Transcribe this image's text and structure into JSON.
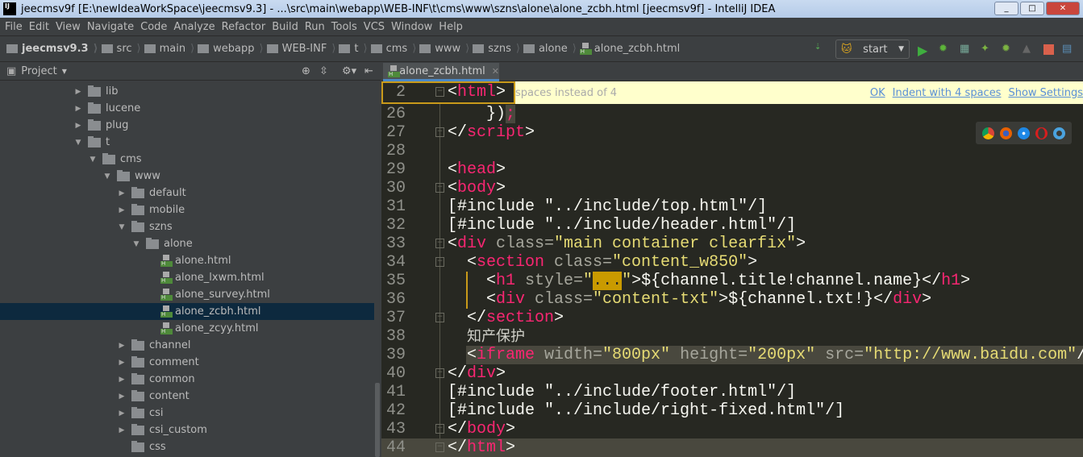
{
  "window": {
    "title": "jeecmsv9f [E:\\newIdeaWorkSpace\\jeecmsv9.3] - ...\\src\\main\\webapp\\WEB-INF\\t\\cms\\www\\szns\\alone\\alone_zcbh.html [jeecmsv9f] - IntelliJ IDEA",
    "logo": "IJ",
    "buttons": [
      "_",
      "□",
      "✕"
    ]
  },
  "menu": [
    "File",
    "Edit",
    "View",
    "Navigate",
    "Code",
    "Analyze",
    "Refactor",
    "Build",
    "Run",
    "Tools",
    "VCS",
    "Window",
    "Help"
  ],
  "breadcrumbs": [
    "jeecmsv9.3",
    "src",
    "main",
    "webapp",
    "WEB-INF",
    "t",
    "cms",
    "www",
    "szns",
    "alone",
    "alone_zcbh.html"
  ],
  "run": {
    "config": "start"
  },
  "project_panel": {
    "title": "Project"
  },
  "tree": [
    {
      "label": "lib",
      "level": 0,
      "type": "folder",
      "state": "collapsed"
    },
    {
      "label": "lucene",
      "level": 0,
      "type": "folder",
      "state": "collapsed"
    },
    {
      "label": "plug",
      "level": 0,
      "type": "folder",
      "state": "collapsed"
    },
    {
      "label": "t",
      "level": 0,
      "type": "folder",
      "state": "expanded"
    },
    {
      "label": "cms",
      "level": 1,
      "type": "folder",
      "state": "expanded"
    },
    {
      "label": "www",
      "level": 2,
      "type": "folder",
      "state": "expanded"
    },
    {
      "label": "default",
      "level": 3,
      "type": "folder",
      "state": "collapsed"
    },
    {
      "label": "mobile",
      "level": 3,
      "type": "folder",
      "state": "collapsed"
    },
    {
      "label": "szns",
      "level": 3,
      "type": "folder",
      "state": "expanded"
    },
    {
      "label": "alone",
      "level": 4,
      "type": "folder",
      "state": "expanded"
    },
    {
      "label": "alone.html",
      "level": 5,
      "type": "html"
    },
    {
      "label": "alone_lxwm.html",
      "level": 5,
      "type": "html"
    },
    {
      "label": "alone_survey.html",
      "level": 5,
      "type": "html"
    },
    {
      "label": "alone_zcbh.html",
      "level": 5,
      "type": "html",
      "selected": true
    },
    {
      "label": "alone_zcyy.html",
      "level": 5,
      "type": "html"
    },
    {
      "label": "channel",
      "level": 3,
      "type": "folder",
      "state": "collapsed"
    },
    {
      "label": "comment",
      "level": 3,
      "type": "folder",
      "state": "collapsed"
    },
    {
      "label": "common",
      "level": 3,
      "type": "folder",
      "state": "collapsed"
    },
    {
      "label": "content",
      "level": 3,
      "type": "folder",
      "state": "collapsed"
    },
    {
      "label": "csi",
      "level": 3,
      "type": "folder",
      "state": "collapsed"
    },
    {
      "label": "csi_custom",
      "level": 3,
      "type": "folder",
      "state": "collapsed"
    },
    {
      "label": "css",
      "level": 3,
      "type": "folder",
      "state": "none"
    }
  ],
  "editor": {
    "tab": "alone_zcbh.html",
    "notification": {
      "message": "spaces instead of 4",
      "links": [
        "OK",
        "Indent with 4 spaces",
        "Show Settings"
      ]
    },
    "sticky": {
      "num": "2",
      "tokens": [
        [
          "<",
          "p"
        ],
        [
          "html",
          "tag"
        ],
        [
          ">",
          "p"
        ]
      ]
    },
    "lines": [
      {
        "num": "26",
        "fold": false,
        "tokens": [
          [
            "    })",
            "p"
          ],
          [
            ";",
            "semi"
          ]
        ]
      },
      {
        "num": "27",
        "fold": true,
        "tokens": [
          [
            "</",
            "p"
          ],
          [
            "script",
            "tag"
          ],
          [
            ">",
            "p"
          ]
        ]
      },
      {
        "num": "28",
        "fold": false,
        "tokens": []
      },
      {
        "num": "29",
        "fold": false,
        "tokens": [
          [
            "<",
            "p"
          ],
          [
            "head",
            "tag"
          ],
          [
            ">",
            "p"
          ]
        ]
      },
      {
        "num": "30",
        "fold": true,
        "tokens": [
          [
            "<",
            "p"
          ],
          [
            "body",
            "tag"
          ],
          [
            ">",
            "p"
          ]
        ]
      },
      {
        "num": "31",
        "fold": false,
        "tokens": [
          [
            "[#include ",
            "p"
          ],
          [
            "\"../include/top.html\"",
            "p"
          ],
          [
            "/]",
            "p"
          ]
        ]
      },
      {
        "num": "32",
        "fold": false,
        "tokens": [
          [
            "[#include ",
            "p"
          ],
          [
            "\"../include/header.html\"",
            "p"
          ],
          [
            "/]",
            "p"
          ]
        ]
      },
      {
        "num": "33",
        "fold": true,
        "tokens": [
          [
            "<",
            "p"
          ],
          [
            "div ",
            "tag"
          ],
          [
            "class=",
            "attr"
          ],
          [
            "\"main container clearfix\"",
            "str"
          ],
          [
            ">",
            "p"
          ]
        ]
      },
      {
        "num": "34",
        "fold": true,
        "tokens": [
          [
            "  <",
            "p"
          ],
          [
            "section ",
            "tag"
          ],
          [
            "class=",
            "attr"
          ],
          [
            "\"content_w850\"",
            "str"
          ],
          [
            ">",
            "p"
          ]
        ]
      },
      {
        "num": "35",
        "fold": false,
        "tokens": [
          [
            "    <",
            "p"
          ],
          [
            "h1 ",
            "tag"
          ],
          [
            "style=",
            "attr"
          ],
          [
            "\"",
            "str"
          ],
          [
            "...",
            "ell"
          ],
          [
            "\"",
            "str"
          ],
          [
            ">${channel.title!channel.name}</",
            "p"
          ],
          [
            "h1",
            "tag"
          ],
          [
            ">",
            "p"
          ]
        ]
      },
      {
        "num": "36",
        "fold": false,
        "tokens": [
          [
            "    <",
            "p"
          ],
          [
            "div ",
            "tag"
          ],
          [
            "class=",
            "attr"
          ],
          [
            "\"content-txt\"",
            "str"
          ],
          [
            ">${channel.txt!}</",
            "p"
          ],
          [
            "div",
            "tag"
          ],
          [
            ">",
            "p"
          ]
        ]
      },
      {
        "num": "37",
        "fold": true,
        "tokens": [
          [
            "  </",
            "p"
          ],
          [
            "section",
            "tag"
          ],
          [
            ">",
            "p"
          ]
        ]
      },
      {
        "num": "38",
        "fold": false,
        "tokens": [
          [
            "  ",
            "p"
          ],
          [
            "知产保护",
            "cn"
          ]
        ]
      },
      {
        "num": "39",
        "fold": false,
        "highlight": true,
        "tokens": [
          [
            "  <",
            "p"
          ],
          [
            "iframe ",
            "tag"
          ],
          [
            "width=",
            "attr"
          ],
          [
            "\"800px\" ",
            "str"
          ],
          [
            "height=",
            "attr"
          ],
          [
            "\"200px\" ",
            "str"
          ],
          [
            "src=",
            "attr"
          ],
          [
            "\"http://www.baidu.com\"",
            "str"
          ],
          [
            "/",
            "p"
          ]
        ]
      },
      {
        "num": "40",
        "fold": true,
        "tokens": [
          [
            "</",
            "p"
          ],
          [
            "div",
            "tag"
          ],
          [
            ">",
            "p"
          ]
        ]
      },
      {
        "num": "41",
        "fold": false,
        "tokens": [
          [
            "[#include ",
            "p"
          ],
          [
            "\"../include/footer.html\"",
            "p"
          ],
          [
            "/]",
            "p"
          ]
        ]
      },
      {
        "num": "42",
        "fold": false,
        "tokens": [
          [
            "[#include ",
            "p"
          ],
          [
            "\"../include/right-fixed.html\"",
            "p"
          ],
          [
            "/]",
            "p"
          ]
        ]
      },
      {
        "num": "43",
        "fold": true,
        "tokens": [
          [
            "</",
            "p"
          ],
          [
            "body",
            "tag"
          ],
          [
            ">",
            "p"
          ]
        ]
      },
      {
        "num": "44",
        "fold": true,
        "highlight": true,
        "tokens": [
          [
            "</",
            "p"
          ],
          [
            "html",
            "tag"
          ],
          [
            ">",
            "p"
          ]
        ]
      }
    ]
  },
  "browsers": [
    "chrome-icon",
    "firefox-icon",
    "safari-icon",
    "opera-icon",
    "ie-icon"
  ],
  "colors": {
    "tag": "#f92672",
    "string": "#e6db74",
    "editor_bg": "#272822",
    "selection": "#0d293e"
  }
}
